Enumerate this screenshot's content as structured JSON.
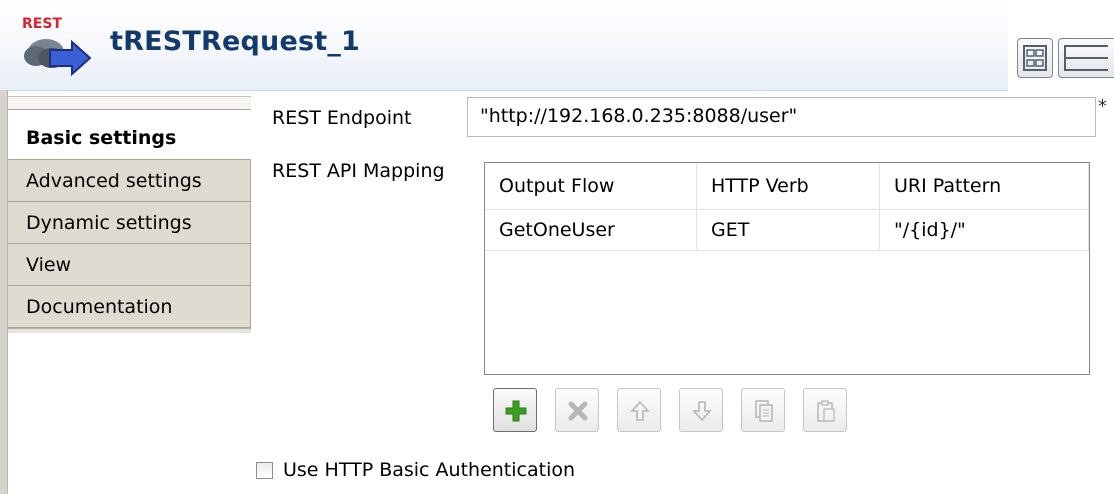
{
  "header": {
    "logo_text": "REST",
    "title": "tRESTRequest_1"
  },
  "tabs": [
    {
      "label": "Basic settings",
      "active": true
    },
    {
      "label": "Advanced settings",
      "active": false
    },
    {
      "label": "Dynamic settings",
      "active": false
    },
    {
      "label": "View",
      "active": false
    },
    {
      "label": "Documentation",
      "active": false
    }
  ],
  "form": {
    "endpoint_label": "REST Endpoint",
    "endpoint_value": "\"http://192.168.0.235:8088/user\"",
    "required_marker": "*",
    "mapping_label": "REST API Mapping",
    "table": {
      "columns": [
        "Output Flow",
        "HTTP Verb",
        "URI Pattern"
      ],
      "rows": [
        [
          "GetOneUser",
          "GET",
          "\"/{id}/\""
        ]
      ]
    },
    "toolbar": [
      {
        "name": "add",
        "icon": "plus-icon",
        "enabled": true
      },
      {
        "name": "remove",
        "icon": "delete-x-icon",
        "enabled": false
      },
      {
        "name": "move-up",
        "icon": "arrow-up-icon",
        "enabled": false
      },
      {
        "name": "move-down",
        "icon": "arrow-down-icon",
        "enabled": false
      },
      {
        "name": "copy",
        "icon": "copy-icon",
        "enabled": false
      },
      {
        "name": "paste",
        "icon": "paste-icon",
        "enabled": false
      }
    ],
    "auth_label": "Use HTTP Basic Authentication",
    "auth_checked": false
  },
  "colors": {
    "title": "#123a6e",
    "add_icon": "#3aa021",
    "logo_red": "#d9232a"
  }
}
